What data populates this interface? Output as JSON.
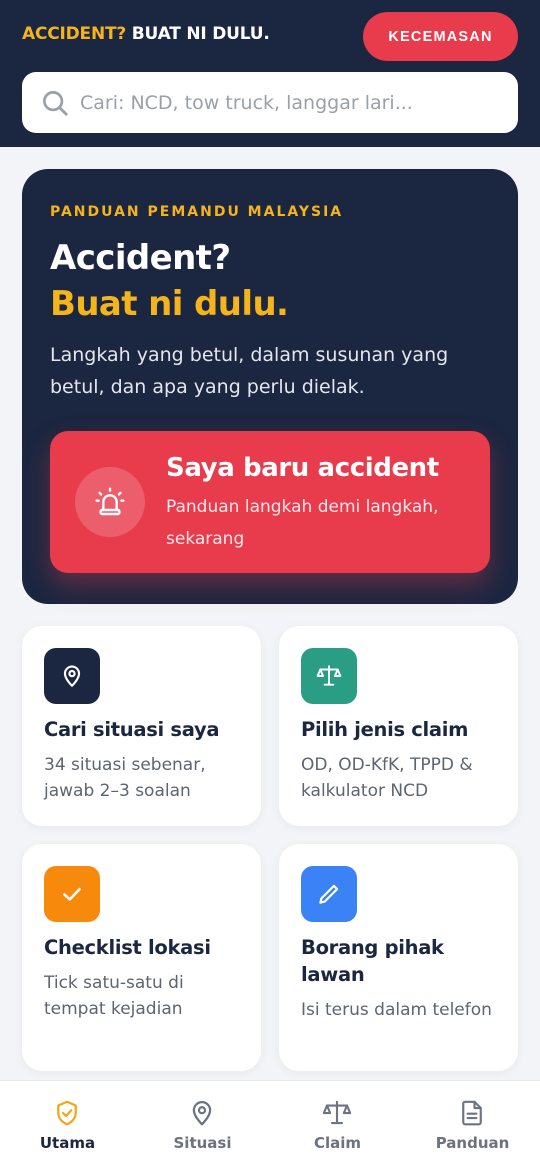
{
  "header": {
    "brand_accent": "ACCIDENT?",
    "brand_rest": " BUAT NI DULU.",
    "emergency_label": "KECEMASAN"
  },
  "search": {
    "placeholder": "Cari: NCD, tow truck, langgar lari...",
    "value": ""
  },
  "hero": {
    "kicker": "PANDUAN PEMANDU MALAYSIA",
    "title_line1": "Accident?",
    "title_line2": "Buat ni dulu.",
    "description": "Langkah yang betul, dalam susunan yang betul, dan apa yang perlu dielak.",
    "cta": {
      "title": "Saya baru accident",
      "subtitle": "Panduan langkah demi langkah, sekarang",
      "icon": "siren-icon"
    }
  },
  "cards": [
    {
      "title": "Cari situasi saya",
      "description": "34 situasi sebenar, jawab 2–3 soalan",
      "icon": "location-pin-icon",
      "color": "#1b2640"
    },
    {
      "title": "Pilih jenis claim",
      "description": "OD, OD-KfK, TPPD & kalkulator NCD",
      "icon": "scale-icon",
      "color": "#2a9d85"
    },
    {
      "title": "Checklist lokasi",
      "description": "Tick satu-satu di tempat kejadian",
      "icon": "check-icon",
      "color": "#f7890c"
    },
    {
      "title": "Borang pihak lawan",
      "description": "Isi terus dalam telefon",
      "icon": "pencil-icon",
      "color": "#3b82f6"
    }
  ],
  "nav": [
    {
      "label": "Utama",
      "icon": "shield-check-icon",
      "active": true
    },
    {
      "label": "Situasi",
      "icon": "location-pin-icon",
      "active": false
    },
    {
      "label": "Claim",
      "icon": "scale-icon",
      "active": false
    },
    {
      "label": "Panduan",
      "icon": "document-icon",
      "active": false
    }
  ],
  "colors": {
    "navy": "#1b2640",
    "accent_yellow": "#f5b41a",
    "emergency_red": "#e83b4c",
    "background": "#f3f4f7"
  }
}
